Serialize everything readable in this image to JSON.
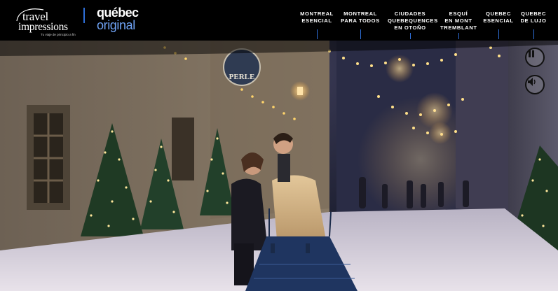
{
  "brand": {
    "travel_line1": "travel",
    "travel_line2": "impressions",
    "travel_tagline": "Tu viaje de principio a fin",
    "quebec_line1": "québec",
    "quebec_line2": "original"
  },
  "nav": {
    "items": [
      {
        "line1": "MONTREAL",
        "line2": "ESENCIAL",
        "line3": ""
      },
      {
        "line1": "MONTREAL",
        "line2": "PARA TODOS",
        "line3": ""
      },
      {
        "line1": "CIUDADES",
        "line2": "QUEBEQUENCES",
        "line3": "EN OTOÑO"
      },
      {
        "line1": "ESQUÍ",
        "line2": "EN MONT",
        "line3": "TREMBLANT"
      },
      {
        "line1": "QUEBEC",
        "line2": "ESENCIAL",
        "line3": ""
      },
      {
        "line1": "QUEBEC",
        "line2": "DE LUJO",
        "line3": ""
      }
    ]
  },
  "hero": {
    "shop_sign": "PERLE",
    "controls": {
      "pause_icon": "pause-icon",
      "sound_icon": "speaker-icon"
    }
  },
  "colors": {
    "header_bg": "#000000",
    "accent_blue": "#2e6fd8",
    "quebec_blue": "#6fa3f5",
    "light_warm": "#ffd98a"
  }
}
